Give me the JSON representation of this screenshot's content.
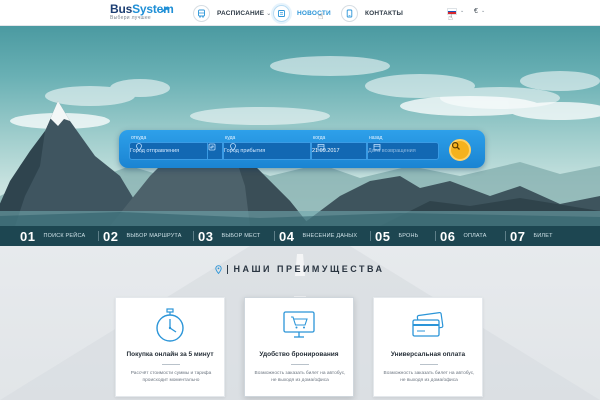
{
  "header": {
    "logo": {
      "part1": "Bus",
      "part2": "System",
      "tagline": "Выбери лучшее"
    },
    "nav": [
      {
        "label": "РАСПИСАНИЕ",
        "icon": "bus-icon",
        "caret": "⌄"
      },
      {
        "label": "НОВОСТИ",
        "icon": "newspaper-icon",
        "active": true
      },
      {
        "label": "КОНТАКТЫ",
        "icon": "phone-icon"
      }
    ],
    "language": {
      "flag": "ru-flag",
      "caret": "⌄"
    },
    "currency": {
      "symbol": "€",
      "caret": "⌄"
    }
  },
  "search": {
    "from": {
      "label": "откуда",
      "placeholder": "Город отправления"
    },
    "to": {
      "label": "куда",
      "placeholder": "Город прибытия"
    },
    "date": {
      "label": "когда",
      "value": "21.09.2017"
    },
    "return_date": {
      "label": "назад",
      "placeholder": "Дата возвращения"
    }
  },
  "steps": [
    {
      "num": "01",
      "label": "ПОИСК РЕЙСА"
    },
    {
      "num": "02",
      "label": "ВЫБОР МАРШРУТА"
    },
    {
      "num": "03",
      "label": "ВЫБОР МЕСТ"
    },
    {
      "num": "04",
      "label": "ВНЕСЕНИЕ ДАНЫХ"
    },
    {
      "num": "05",
      "label": "БРОНЬ"
    },
    {
      "num": "06",
      "label": "ОПЛАТА"
    },
    {
      "num": "07",
      "label": "БИЛЕТ"
    }
  ],
  "advantages": {
    "title": "НАШИ ПРЕИМУЩЕСТВА",
    "cards": [
      {
        "icon": "stopwatch-icon",
        "title": "Покупка онлайн за 5 минут",
        "text": "Рассчёт стоимости суммы и тарифа происходит моментально"
      },
      {
        "icon": "online-booking-icon",
        "title": "Удобство бронирования",
        "text": "Возможность заказать билет на автобус, не выходя из дома/офиса"
      },
      {
        "icon": "credit-cards-icon",
        "title": "Универсальная оплата",
        "text": "Возможность заказать билет на автобус, не выходя из дома/офиса"
      }
    ]
  },
  "colors": {
    "primary": "#1f8fd6",
    "accent": "#f5b21d",
    "dark": "#1d4651",
    "brand_dark": "#1d3f73"
  }
}
